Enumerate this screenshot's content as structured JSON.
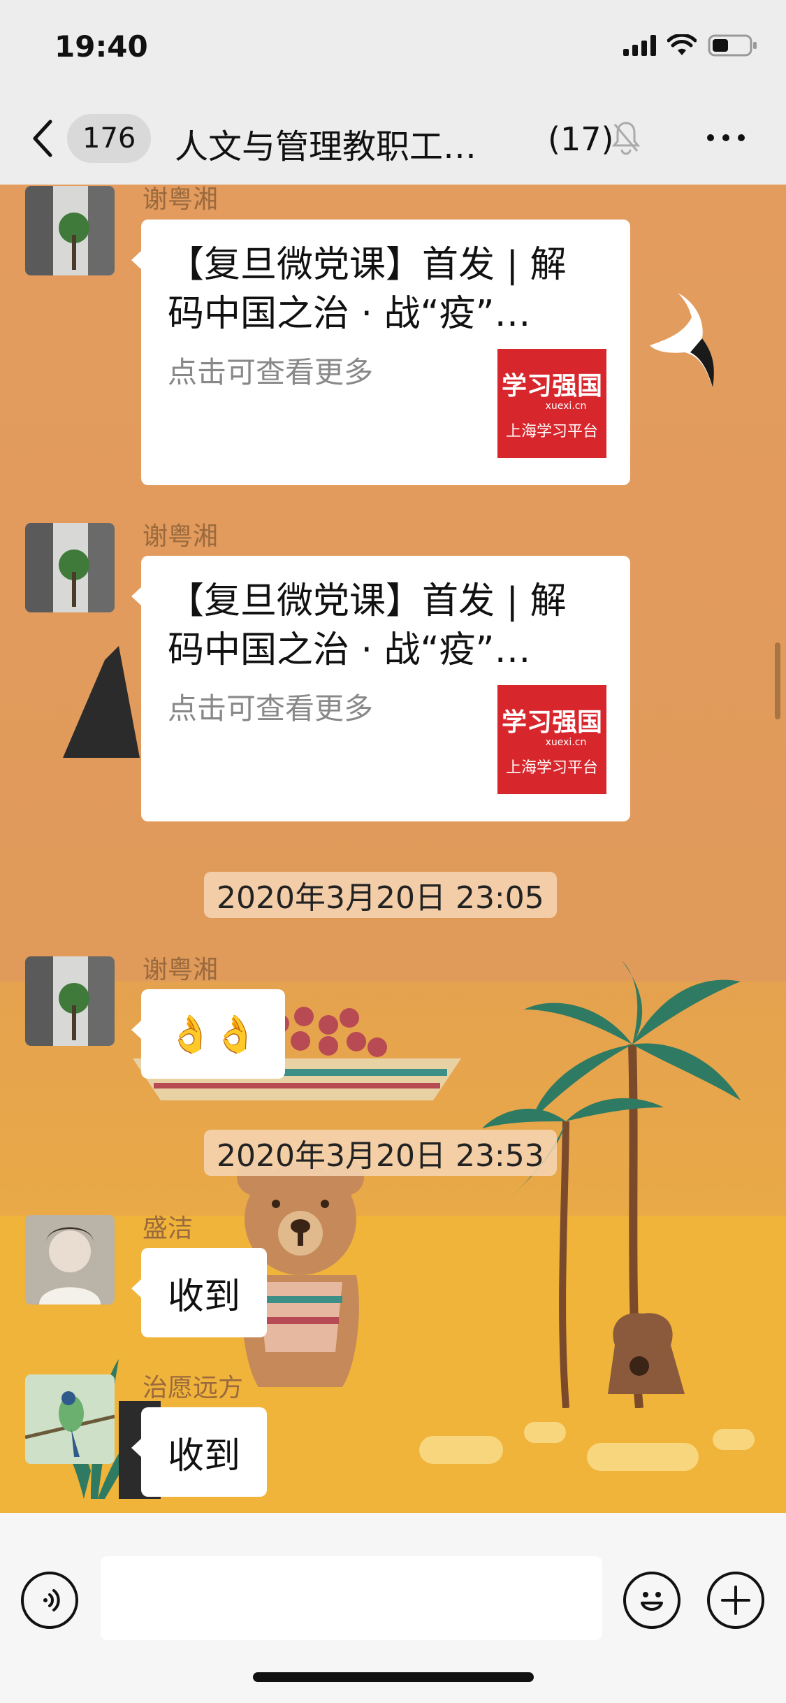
{
  "status_bar": {
    "time": "19:40"
  },
  "nav": {
    "unread_count": "176",
    "title": "人文与管理教职工…",
    "member_count": "(17)"
  },
  "messages": [
    {
      "sender": "谢粤湘",
      "type": "card",
      "title": "【复旦微党课】首发 | 解码中国之治 · 战“疫”…",
      "desc": "点击可查看更多",
      "logo_text": "学习强国",
      "logo_sub": "xuexi.cn",
      "logo_caption": "上海学习平台"
    },
    {
      "sender": "谢粤湘",
      "type": "card",
      "title": "【复旦微党课】首发 | 解码中国之治 · 战“疫”…",
      "desc": "点击可查看更多",
      "logo_text": "学习强国",
      "logo_sub": "xuexi.cn",
      "logo_caption": "上海学习平台"
    },
    {
      "type": "timestamp",
      "text": "2020年3月20日 23:05"
    },
    {
      "sender": "谢粤湘",
      "type": "text",
      "text": "👌👌"
    },
    {
      "type": "timestamp",
      "text": "2020年3月20日 23:53"
    },
    {
      "sender": "盛洁",
      "type": "text",
      "text": "收到"
    },
    {
      "sender": "治愿远方",
      "type": "text",
      "text": "收到"
    }
  ]
}
